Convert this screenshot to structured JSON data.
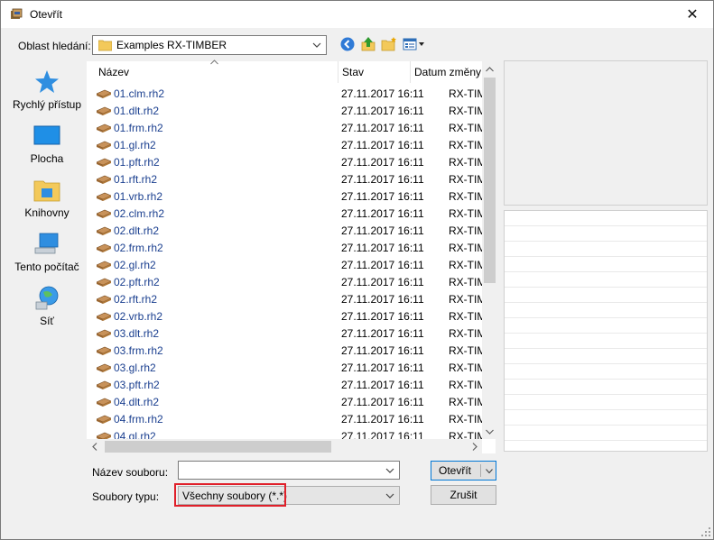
{
  "window": {
    "title": "Otevřít",
    "close_symbol": "✕"
  },
  "lookin": {
    "label": "Oblast hledání:",
    "value": "Examples RX-TIMBER"
  },
  "toolbar": {
    "back": "back-arrow-icon",
    "up": "up-folder-icon",
    "newfolder": "new-folder-icon",
    "view": "view-menu-icon"
  },
  "places": [
    {
      "label": "Rychlý přístup",
      "icon": "star-icon"
    },
    {
      "label": "Plocha",
      "icon": "desktop-icon"
    },
    {
      "label": "Knihovny",
      "icon": "libraries-icon"
    },
    {
      "label": "Tento počítač",
      "icon": "computer-icon"
    },
    {
      "label": "Síť",
      "icon": "network-icon"
    }
  ],
  "columns": {
    "name": "Název",
    "status": "Stav",
    "date": "Datum změny"
  },
  "files": [
    {
      "name": "01.clm.rh2",
      "date": "27.11.2017 16:11",
      "type": "RX-TIMBER"
    },
    {
      "name": "01.dlt.rh2",
      "date": "27.11.2017 16:11",
      "type": "RX-TIMBER"
    },
    {
      "name": "01.frm.rh2",
      "date": "27.11.2017 16:11",
      "type": "RX-TIMBER"
    },
    {
      "name": "01.gl.rh2",
      "date": "27.11.2017 16:11",
      "type": "RX-TIMBER"
    },
    {
      "name": "01.pft.rh2",
      "date": "27.11.2017 16:11",
      "type": "RX-TIMBER"
    },
    {
      "name": "01.rft.rh2",
      "date": "27.11.2017 16:11",
      "type": "RX-TIMBER"
    },
    {
      "name": "01.vrb.rh2",
      "date": "27.11.2017 16:11",
      "type": "RX-TIMBER"
    },
    {
      "name": "02.clm.rh2",
      "date": "27.11.2017 16:11",
      "type": "RX-TIMBER"
    },
    {
      "name": "02.dlt.rh2",
      "date": "27.11.2017 16:11",
      "type": "RX-TIMBER"
    },
    {
      "name": "02.frm.rh2",
      "date": "27.11.2017 16:11",
      "type": "RX-TIMBER"
    },
    {
      "name": "02.gl.rh2",
      "date": "27.11.2017 16:11",
      "type": "RX-TIMBER"
    },
    {
      "name": "02.pft.rh2",
      "date": "27.11.2017 16:11",
      "type": "RX-TIMBER"
    },
    {
      "name": "02.rft.rh2",
      "date": "27.11.2017 16:11",
      "type": "RX-TIMBER"
    },
    {
      "name": "02.vrb.rh2",
      "date": "27.11.2017 16:11",
      "type": "RX-TIMBER"
    },
    {
      "name": "03.dlt.rh2",
      "date": "27.11.2017 16:11",
      "type": "RX-TIMBER"
    },
    {
      "name": "03.frm.rh2",
      "date": "27.11.2017 16:11",
      "type": "RX-TIMBER"
    },
    {
      "name": "03.gl.rh2",
      "date": "27.11.2017 16:11",
      "type": "RX-TIMBER"
    },
    {
      "name": "03.pft.rh2",
      "date": "27.11.2017 16:11",
      "type": "RX-TIMBER"
    },
    {
      "name": "04.dlt.rh2",
      "date": "27.11.2017 16:11",
      "type": "RX-TIMBER"
    },
    {
      "name": "04.frm.rh2",
      "date": "27.11.2017 16:11",
      "type": "RX-TIMBER"
    },
    {
      "name": "04.gl.rh2",
      "date": "27.11.2017 16:11",
      "type": "RX-TIMBER"
    }
  ],
  "filename": {
    "label": "Název souboru:",
    "value": "",
    "placeholder": ""
  },
  "filetype": {
    "label": "Soubory typu:",
    "value": "Všechny soubory (*.*)"
  },
  "buttons": {
    "open": "Otevřít",
    "cancel": "Zrušit"
  },
  "colors": {
    "highlight": "#e0202a",
    "link": "#1a3f8f",
    "accent": "#0078d7"
  }
}
